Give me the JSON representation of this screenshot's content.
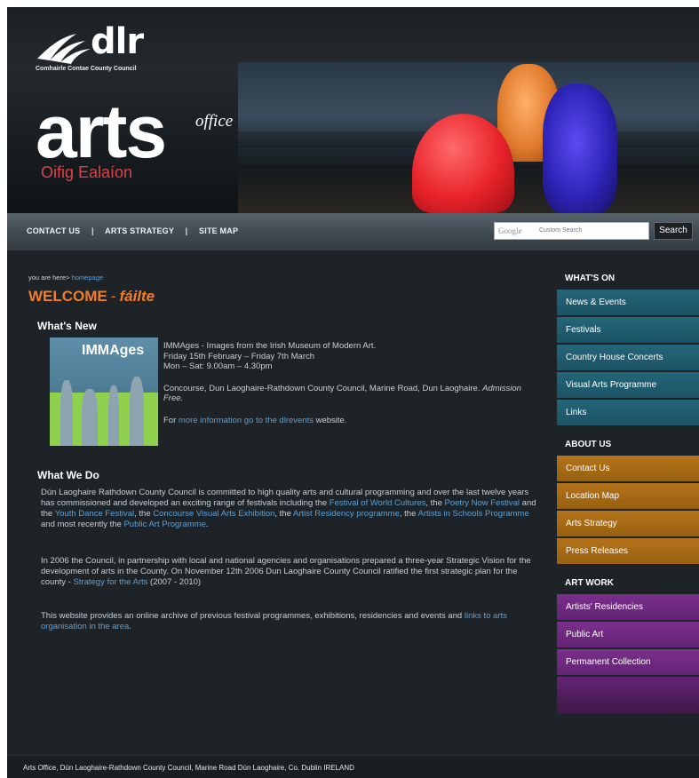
{
  "header": {
    "logo_text": "dlr",
    "council_name": "Comhairle Contae County Council",
    "title": "arts",
    "title_super": "office",
    "irish_title": "Oifig Ealaíon"
  },
  "nav": {
    "links": [
      "CONTACT US",
      "ARTS STRATEGY",
      "SITE MAP"
    ],
    "separator": "|",
    "search": {
      "brand": "Google",
      "placeholder": "Custom Search",
      "button": "Search"
    }
  },
  "breadcrumb": {
    "prefix": "you are here>",
    "link": "homepage"
  },
  "welcome": {
    "english": "WELCOME",
    "sep": "-",
    "irish": "fáilte"
  },
  "whats_new": {
    "heading": "What's New",
    "image_title": "IMMAges",
    "line1": "IMMAges - Images from the Irish Museum of Modern Art.",
    "line2": "Friday 15th February – Friday 7th March",
    "line3": "Mon – Sat: 9.00am – 4.30pm",
    "venue": "Concourse, Dun Laoghaire-Rathdown County Council, Marine Road, Dun Laoghaire.",
    "admission": "Admission Free.",
    "more_prefix": "For",
    "more_link": "more information go to the dlrevents",
    "more_suffix": "website."
  },
  "what_we_do": {
    "heading": "What We Do",
    "p1_a": "Dún Laoghaire Rathdown County Council is committed to high quality arts and cultural programming and over the last twelve years has commissioned and developed an exciting range of festivals including the",
    "p1_link1": "Festival of World Cultures",
    "p1_b": ", the",
    "p1_link2": "Poetry Now Festival",
    "p1_c": "and the",
    "p1_link3": "Youth Dance Festival",
    "p1_d": ", the",
    "p1_link4": "Concourse Visual Arts Exhibition",
    "p1_e": ", the",
    "p1_link5": "Artist Residency programme",
    "p1_f": ", the",
    "p1_link6": "Artists in Schools Programme",
    "p1_g": "and most recently the",
    "p1_link7": "Public Art Programme",
    "p1_h": ".",
    "p2_a": "In 2006 the Council, in partnership with local and national agencies and organisations prepared a three-year Strategic Vision for the development of arts in the County. On November 12th 2006 Dun Laoghaire County Council ratified the first strategic plan for the county -",
    "p2_link": "Strategy for the Arts",
    "p2_b": "(2007 - 2010)",
    "p3_a": "This website provides an online archive of previous festival programmes, exhibitions, residencies and events and",
    "p3_link": "links to arts organisation in the area",
    "p3_b": "."
  },
  "sidebar": {
    "whats_on": {
      "heading": "WHAT'S ON",
      "items": [
        "News & Events",
        "Festivals",
        "Country House Concerts",
        "Visual Arts Programme",
        "Links"
      ]
    },
    "about_us": {
      "heading": "ABOUT US",
      "items": [
        "Contact Us",
        "Location Map",
        "Arts Strategy",
        "Press Releases"
      ]
    },
    "art_work": {
      "heading": "ART WORK",
      "items": [
        "Artists' Residencies",
        "Public Art",
        "Permanent Collection"
      ]
    }
  },
  "footer": {
    "text": "Arts Office, Dún Laoghaire-Rathdown County Council, Marine Road Dún Laoghaire, Co. Dublin IRELAND"
  },
  "colors": {
    "background": "#1e2327",
    "accent_orange": "#f07d2a",
    "link_blue": "#5aa0d6",
    "teal": "#246679",
    "amber": "#b5731a",
    "purple": "#7a2f8c"
  }
}
